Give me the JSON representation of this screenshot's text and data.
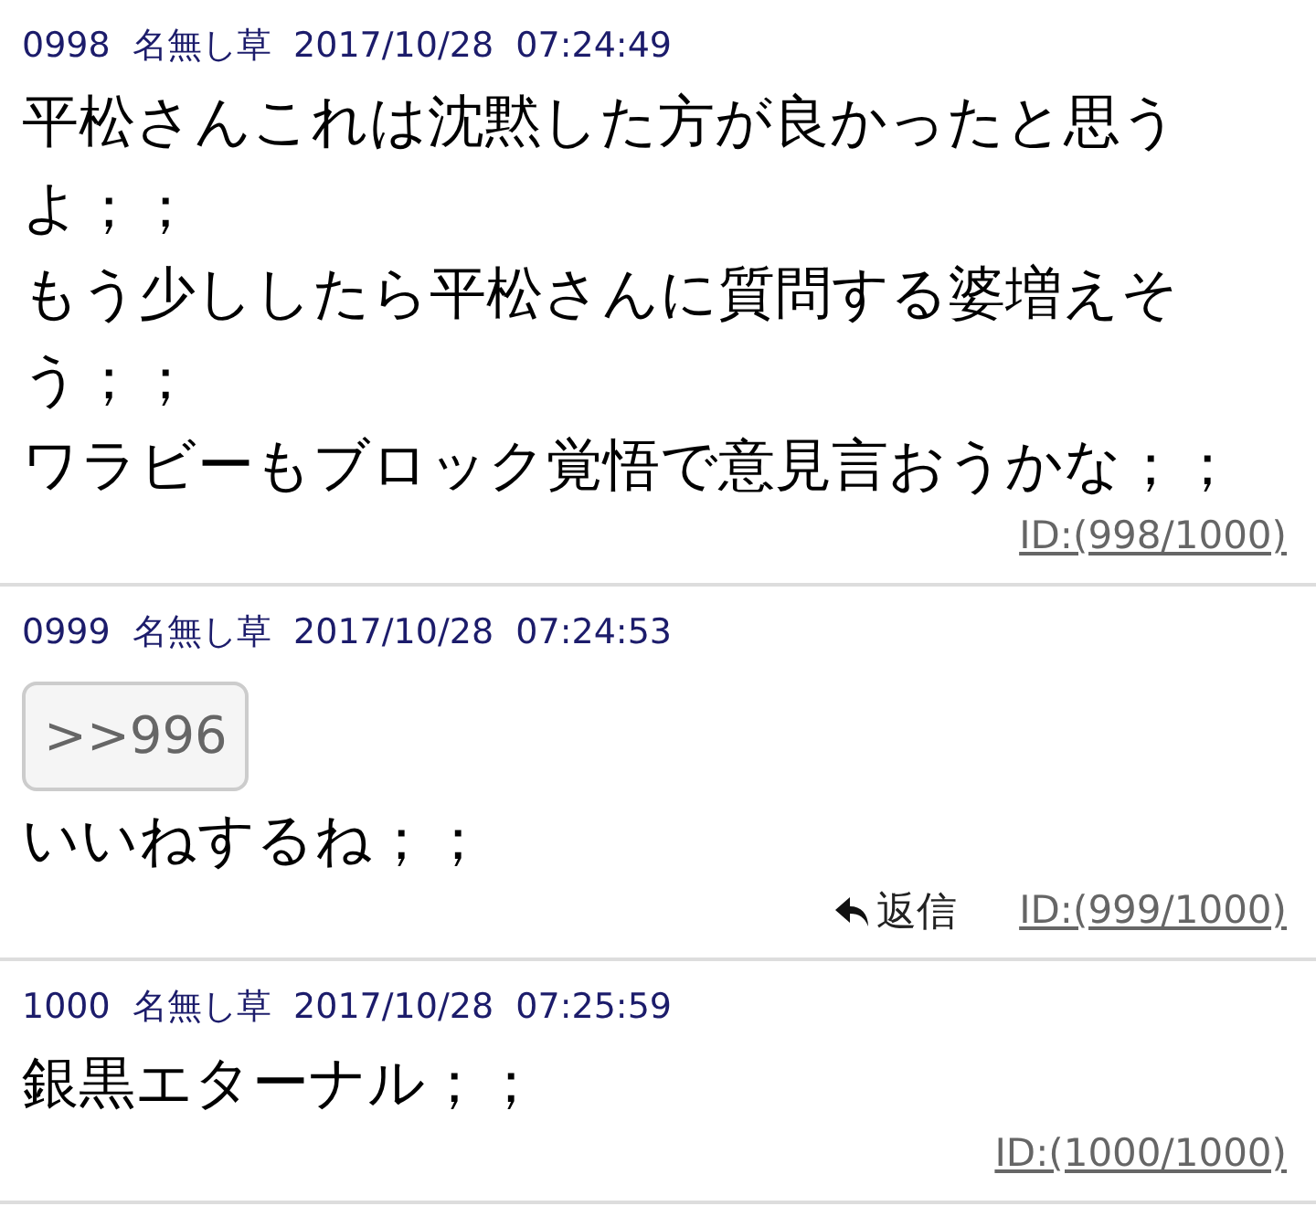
{
  "posts": [
    {
      "number": "0998",
      "name": "名無し草",
      "date": "2017/10/28",
      "time": "07:24:49",
      "body_lines": [
        "平松さんこれは沈黙した方が良かったと思う",
        "よ；；",
        "もう少ししたら平松さんに質問する婆増えそ",
        "う；；",
        "ワラビーもブロック覚悟で意見言おうかな；；"
      ],
      "id_link": "ID:(998/1000)"
    },
    {
      "number": "0999",
      "name": "名無し草",
      "date": "2017/10/28",
      "time": "07:24:53",
      "quotes": [
        ">>996"
      ],
      "body_lines": [
        "いいねするね；；"
      ],
      "reply_label": "返信",
      "id_link": "ID:(999/1000)"
    },
    {
      "number": "1000",
      "name": "名無し草",
      "date": "2017/10/28",
      "time": "07:25:59",
      "body_lines": [
        "銀黒エターナル；；"
      ],
      "id_link": "ID:(1000/1000)"
    }
  ]
}
